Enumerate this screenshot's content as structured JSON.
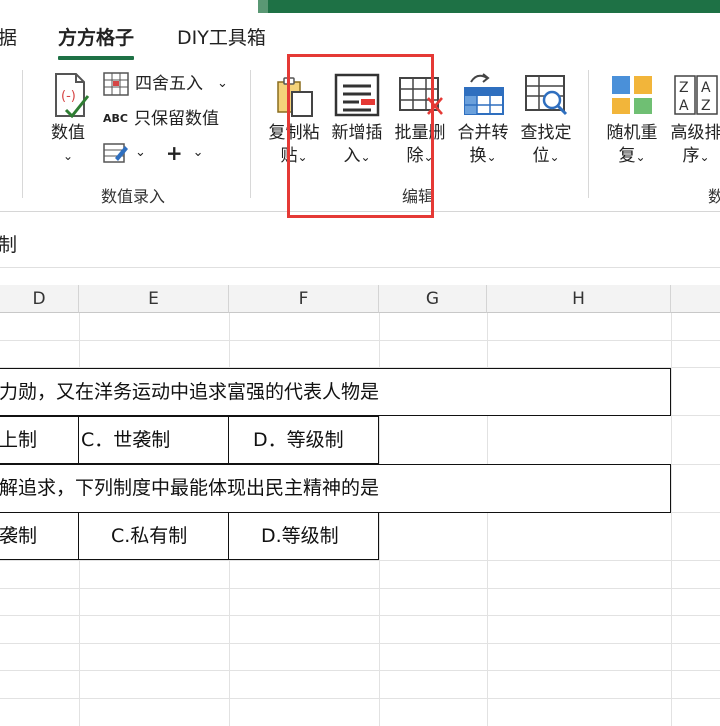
{
  "tabs": [
    {
      "label": "据",
      "active": false
    },
    {
      "label": "方方格子",
      "active": true
    },
    {
      "label": "DIY工具箱",
      "active": false
    }
  ],
  "ribbon": {
    "shuzhi": {
      "label_line1": "数值",
      "caret": "⌄"
    },
    "small_items": [
      {
        "label": "四舍五入",
        "icon": "round-icon",
        "caret": "⌄"
      },
      {
        "label": "只保留数值",
        "icon": "abc-icon"
      },
      {
        "edit_icon": "edit-cell-icon",
        "caret": "⌄",
        "plus": "+",
        "plus_caret": "⌄"
      }
    ],
    "group1_label": "数值录入",
    "buttons": [
      {
        "line1": "复制粘",
        "line2": "贴",
        "icon": "copy-paste-icon"
      },
      {
        "line1": "新增插",
        "line2": "入",
        "icon": "insert-icon"
      },
      {
        "line1": "批量删",
        "line2": "除",
        "icon": "batch-delete-icon"
      },
      {
        "line1": "合并转",
        "line2": "换",
        "icon": "merge-convert-icon"
      },
      {
        "line1": "查找定",
        "line2": "位",
        "icon": "find-locate-icon"
      },
      {
        "line1": "随机重",
        "line2": "复",
        "icon": "random-repeat-icon"
      },
      {
        "line1": "高级排",
        "line2": "序",
        "icon": "advanced-sort-icon"
      }
    ],
    "group2_label": "编辑",
    "group3_label": "数",
    "caret": "⌄"
  },
  "formula_bar": {
    "text": "制"
  },
  "columns": [
    "D",
    "E",
    "F",
    "G",
    "H"
  ],
  "cells": {
    "q1": "力勋，又在洋务运动中追求富强的代表人物是",
    "q1_b": "上制",
    "q1_c": "C．世袭制",
    "q1_d": "D．等级制",
    "q2": "解追求，下列制度中最能体现出民主精神的是",
    "q2_b": "袭制",
    "q2_c": "C.私有制",
    "q2_d": "D.等级制"
  },
  "colors": {
    "accent": "#1e7145",
    "highlight": "#e53935"
  }
}
